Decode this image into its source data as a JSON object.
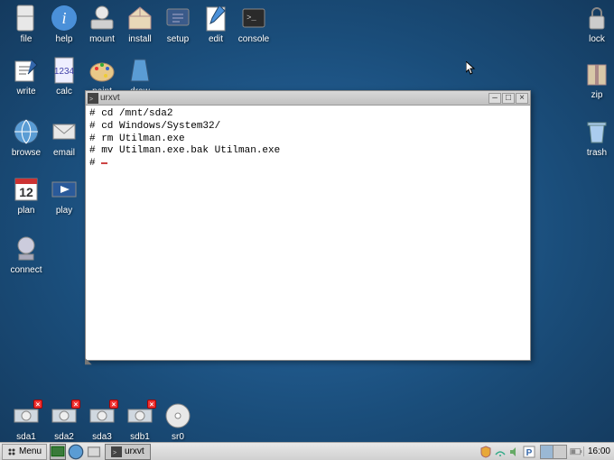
{
  "desktop": {
    "icons_row1": [
      {
        "label": "file",
        "name": "file-icon"
      },
      {
        "label": "help",
        "name": "help-icon"
      },
      {
        "label": "mount",
        "name": "mount-icon"
      },
      {
        "label": "install",
        "name": "install-icon"
      },
      {
        "label": "setup",
        "name": "setup-icon"
      },
      {
        "label": "edit",
        "name": "edit-icon"
      },
      {
        "label": "console",
        "name": "console-icon"
      }
    ],
    "icons_row2": [
      {
        "label": "write",
        "name": "write-icon"
      },
      {
        "label": "calc",
        "name": "calc-icon"
      },
      {
        "label": "paint",
        "name": "paint-icon"
      },
      {
        "label": "draw",
        "name": "draw-icon"
      }
    ],
    "icons_row3": [
      {
        "label": "browse",
        "name": "browse-icon"
      },
      {
        "label": "email",
        "name": "email-icon"
      }
    ],
    "icons_row4": [
      {
        "label": "plan",
        "name": "plan-icon"
      },
      {
        "label": "play",
        "name": "play-icon"
      }
    ],
    "icons_row5": [
      {
        "label": "connect",
        "name": "connect-icon"
      }
    ],
    "icons_right": [
      {
        "label": "lock",
        "name": "lock-icon"
      },
      {
        "label": "zip",
        "name": "zip-icon"
      },
      {
        "label": "trash",
        "name": "trash-icon"
      }
    ],
    "drives": [
      {
        "label": "sda1",
        "badge": true
      },
      {
        "label": "sda2",
        "badge": true
      },
      {
        "label": "sda3",
        "badge": true
      },
      {
        "label": "sdb1",
        "badge": true
      },
      {
        "label": "sr0",
        "badge": false
      }
    ]
  },
  "window": {
    "title": "urxvt",
    "lines": [
      "# cd /mnt/sda2",
      "# cd Windows/System32/",
      "# rm Utilman.exe",
      "# mv Utilman.exe.bak Utilman.exe",
      "# "
    ]
  },
  "taskbar": {
    "menu_label": "Menu",
    "task_label": "urxvt",
    "clock": "16:00"
  }
}
